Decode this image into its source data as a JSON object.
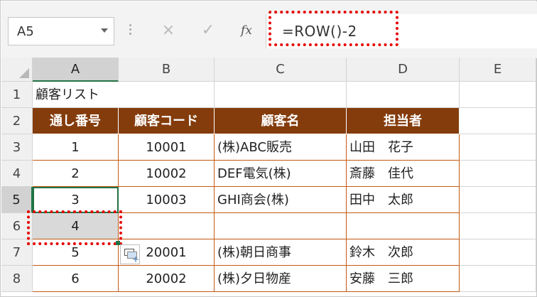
{
  "formula_bar": {
    "name_box": "A5",
    "cancel_icon": "×",
    "enter_icon": "✓",
    "fx_label": "fx",
    "formula": "=ROW()-2"
  },
  "columns": [
    "A",
    "B",
    "C",
    "D",
    "E"
  ],
  "rows": [
    "1",
    "2",
    "3",
    "4",
    "5",
    "6",
    "7",
    "8"
  ],
  "sheet": {
    "title": "顧客リスト",
    "headers": [
      "通し番号",
      "顧客コード",
      "顧客名",
      "担当者"
    ],
    "data": [
      [
        "1",
        "10001",
        "(株)ABC販売",
        "山田　花子"
      ],
      [
        "2",
        "10002",
        "DEF電気(株)",
        "斎藤　佳代"
      ],
      [
        "3",
        "10003",
        "GHI商会(株)",
        "田中　太郎"
      ],
      [
        "4",
        "",
        "",
        ""
      ],
      [
        "5",
        "20001",
        "(株)朝日商事",
        "鈴木　次郎"
      ],
      [
        "6",
        "20002",
        "(株)夕日物産",
        "安藤　三郎"
      ]
    ]
  },
  "selection": {
    "active_cell": "A5",
    "highlighted_cell": "A6"
  },
  "colors": {
    "header_fill": "#843c0c",
    "border": "#c55a11",
    "select_green": "#217346",
    "annotation_red": "#e60000"
  }
}
